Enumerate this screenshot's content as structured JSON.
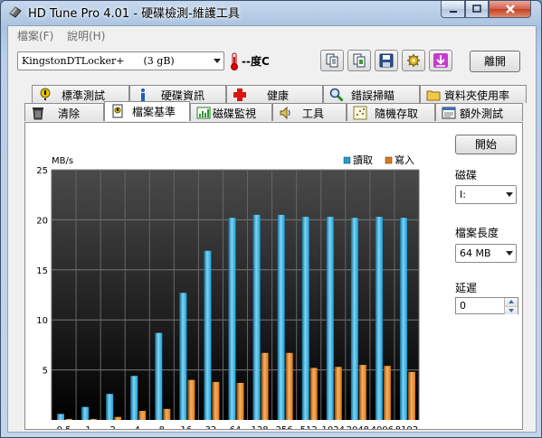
{
  "window": {
    "title": "HD Tune Pro 4.01 - 硬碟檢測-維護工具"
  },
  "menu": {
    "file": "檔案(F)",
    "help": "說明(H)"
  },
  "toolbar": {
    "drive": "KingstonDTLocker+      (3 gB)",
    "temperature": "--度C",
    "exit_label": "離開",
    "icons": [
      "copy-text-icon",
      "copy-screen-icon",
      "save-icon",
      "options-icon",
      "download-icon"
    ]
  },
  "tabs_top": [
    {
      "label": "標準測試",
      "icon": "exclamation-icon"
    },
    {
      "label": "硬碟資訊",
      "icon": "info-icon"
    },
    {
      "label": "健康",
      "icon": "health-cross-icon"
    },
    {
      "label": "錯誤掃瞄",
      "icon": "magnifier-icon"
    },
    {
      "label": "資料夾使用率",
      "icon": "folder-icon"
    }
  ],
  "tabs_bottom": [
    {
      "label": "清除",
      "icon": "trash-icon"
    },
    {
      "label": "檔案基準",
      "icon": "file-benchmark-icon",
      "active": true
    },
    {
      "label": "磁碟監視",
      "icon": "disk-monitor-icon"
    },
    {
      "label": "工具",
      "icon": "speaker-icon"
    },
    {
      "label": "隨機存取",
      "icon": "random-access-icon"
    },
    {
      "label": "額外測試",
      "icon": "extra-tests-icon"
    }
  ],
  "side": {
    "start_label": "開始",
    "disk_label": "磁碟",
    "disk_value": "I:",
    "file_length_label": "檔案長度",
    "file_length_value": "64 MB",
    "delay_label": "延遲",
    "delay_value": "0"
  },
  "chart_data": {
    "type": "bar",
    "ylabel": "MB/s",
    "ylim": [
      0,
      25
    ],
    "yticks": [
      5,
      10,
      15,
      20,
      25
    ],
    "categories": [
      "0.5",
      "1",
      "2",
      "4",
      "8",
      "16",
      "32",
      "64",
      "128",
      "256",
      "512",
      "1024",
      "2048",
      "4096",
      "8192"
    ],
    "series": [
      {
        "name": "讀取",
        "color": "#1aa0d8",
        "values": [
          0.6,
          1.3,
          2.6,
          4.4,
          8.7,
          12.7,
          16.9,
          20.2,
          20.5,
          20.5,
          20.3,
          20.3,
          20.2,
          20.3,
          20.2
        ]
      },
      {
        "name": "寫入",
        "color": "#e07a12",
        "values": [
          0.1,
          0.1,
          0.3,
          0.9,
          1.1,
          4.0,
          3.8,
          3.7,
          6.7,
          6.7,
          5.2,
          5.3,
          5.5,
          5.4,
          4.8
        ]
      }
    ],
    "grid": true,
    "legend": "top-right",
    "background": "#000000"
  }
}
